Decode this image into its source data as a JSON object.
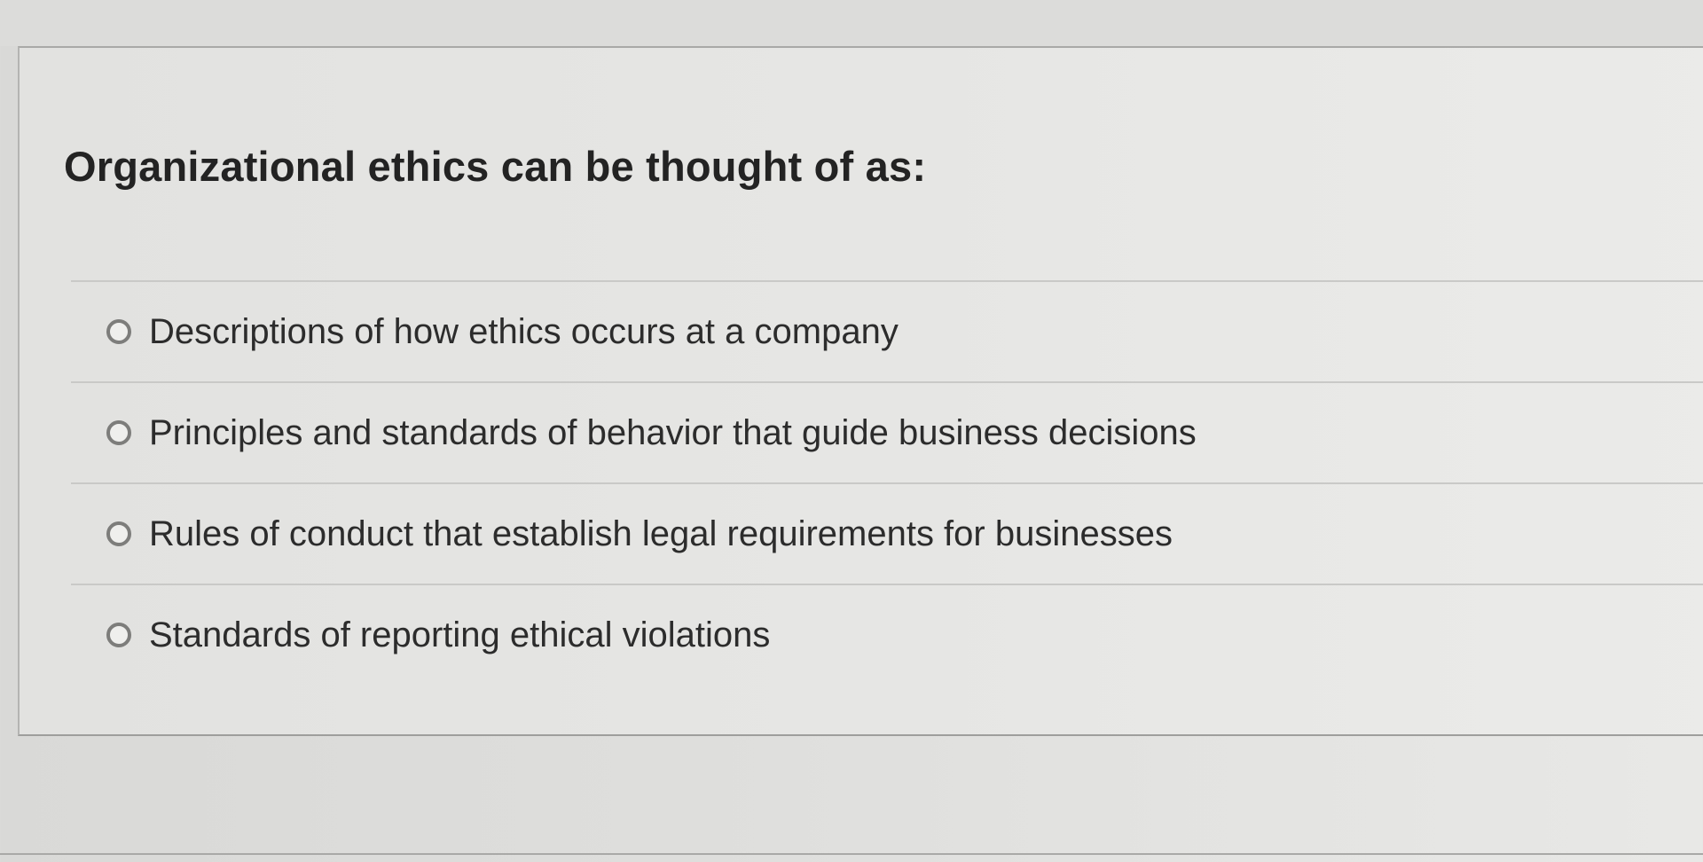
{
  "question": {
    "text": "Organizational ethics can be thought of as:"
  },
  "answers": [
    {
      "label": "Descriptions of how ethics occurs at a company",
      "selected": false
    },
    {
      "label": "Principles and standards of behavior that guide business decisions",
      "selected": false
    },
    {
      "label": "Rules of conduct that establish legal requirements for businesses",
      "selected": false
    },
    {
      "label": "Standards of reporting ethical violations",
      "selected": false
    }
  ],
  "colors": {
    "background": "#e2e2e0",
    "text": "#232323",
    "divider": "#c9c9c7",
    "radio_border": "#7d7d7b"
  }
}
